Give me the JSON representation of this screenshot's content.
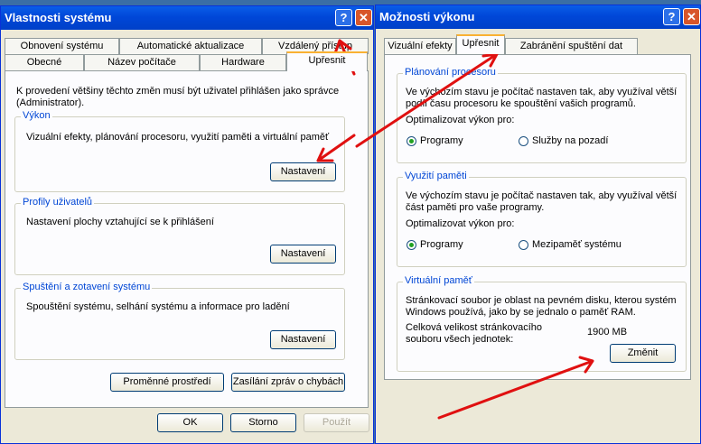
{
  "left_window": {
    "title": "Vlastnosti systému",
    "tabs_row1": [
      "Obnovení systému",
      "Automatické aktualizace",
      "Vzdálený přístup"
    ],
    "tabs_row2": [
      "Obecné",
      "Název počítače",
      "Hardware",
      "Upřesnit"
    ],
    "info": "K provedení většiny těchto změn musí být uživatel přihlášen jako správce (Administrator).",
    "vykon": {
      "legend": "Výkon",
      "text": "Vizuální efekty, plánování procesoru, využití paměti a virtuální paměť",
      "button": "Nastavení"
    },
    "profily": {
      "legend": "Profily uživatelů",
      "text": "Nastavení plochy vztahující se k přihlášení",
      "button": "Nastavení"
    },
    "spusteni": {
      "legend": "Spuštění a zotavení systému",
      "text": "Spouštění systému, selhání systému a informace pro ladění",
      "button": "Nastavení"
    },
    "env_button": "Proměnné prostředí",
    "error_button": "Zasílání zpráv o chybách",
    "ok": "OK",
    "cancel": "Storno",
    "apply": "Použít"
  },
  "right_window": {
    "title": "Možnosti výkonu",
    "tabs": [
      "Vizuální efekty",
      "Upřesnit",
      "Zabránění spuštění dat (DEP)"
    ],
    "planovani": {
      "legend": "Plánování procesoru",
      "text": "Ve výchozím stavu je počítač nastaven tak, aby využíval větší podíl času procesoru ke spouštění vašich programů.",
      "optimize": "Optimalizovat výkon pro:",
      "opt1": "Programy",
      "opt2": "Služby na pozadí"
    },
    "pamet": {
      "legend": "Využití paměti",
      "text": "Ve výchozím stavu je počítač nastaven tak, aby využíval větší část paměti pro vaše programy.",
      "optimize": "Optimalizovat výkon pro:",
      "opt1": "Programy",
      "opt2": "Mezipaměť systému"
    },
    "virtualni": {
      "legend": "Virtuální paměť",
      "text": "Stránkovací soubor je oblast na pevném disku, kterou systém Windows používá, jako by se jednalo o paměť RAM.",
      "total_label": "Celková velikost stránkovacího souboru všech jednotek:",
      "total_value": "1900 MB",
      "button": "Změnit"
    }
  },
  "colors": {
    "annotation_arrow": "#e01010",
    "titlebar": "#0047d8"
  }
}
